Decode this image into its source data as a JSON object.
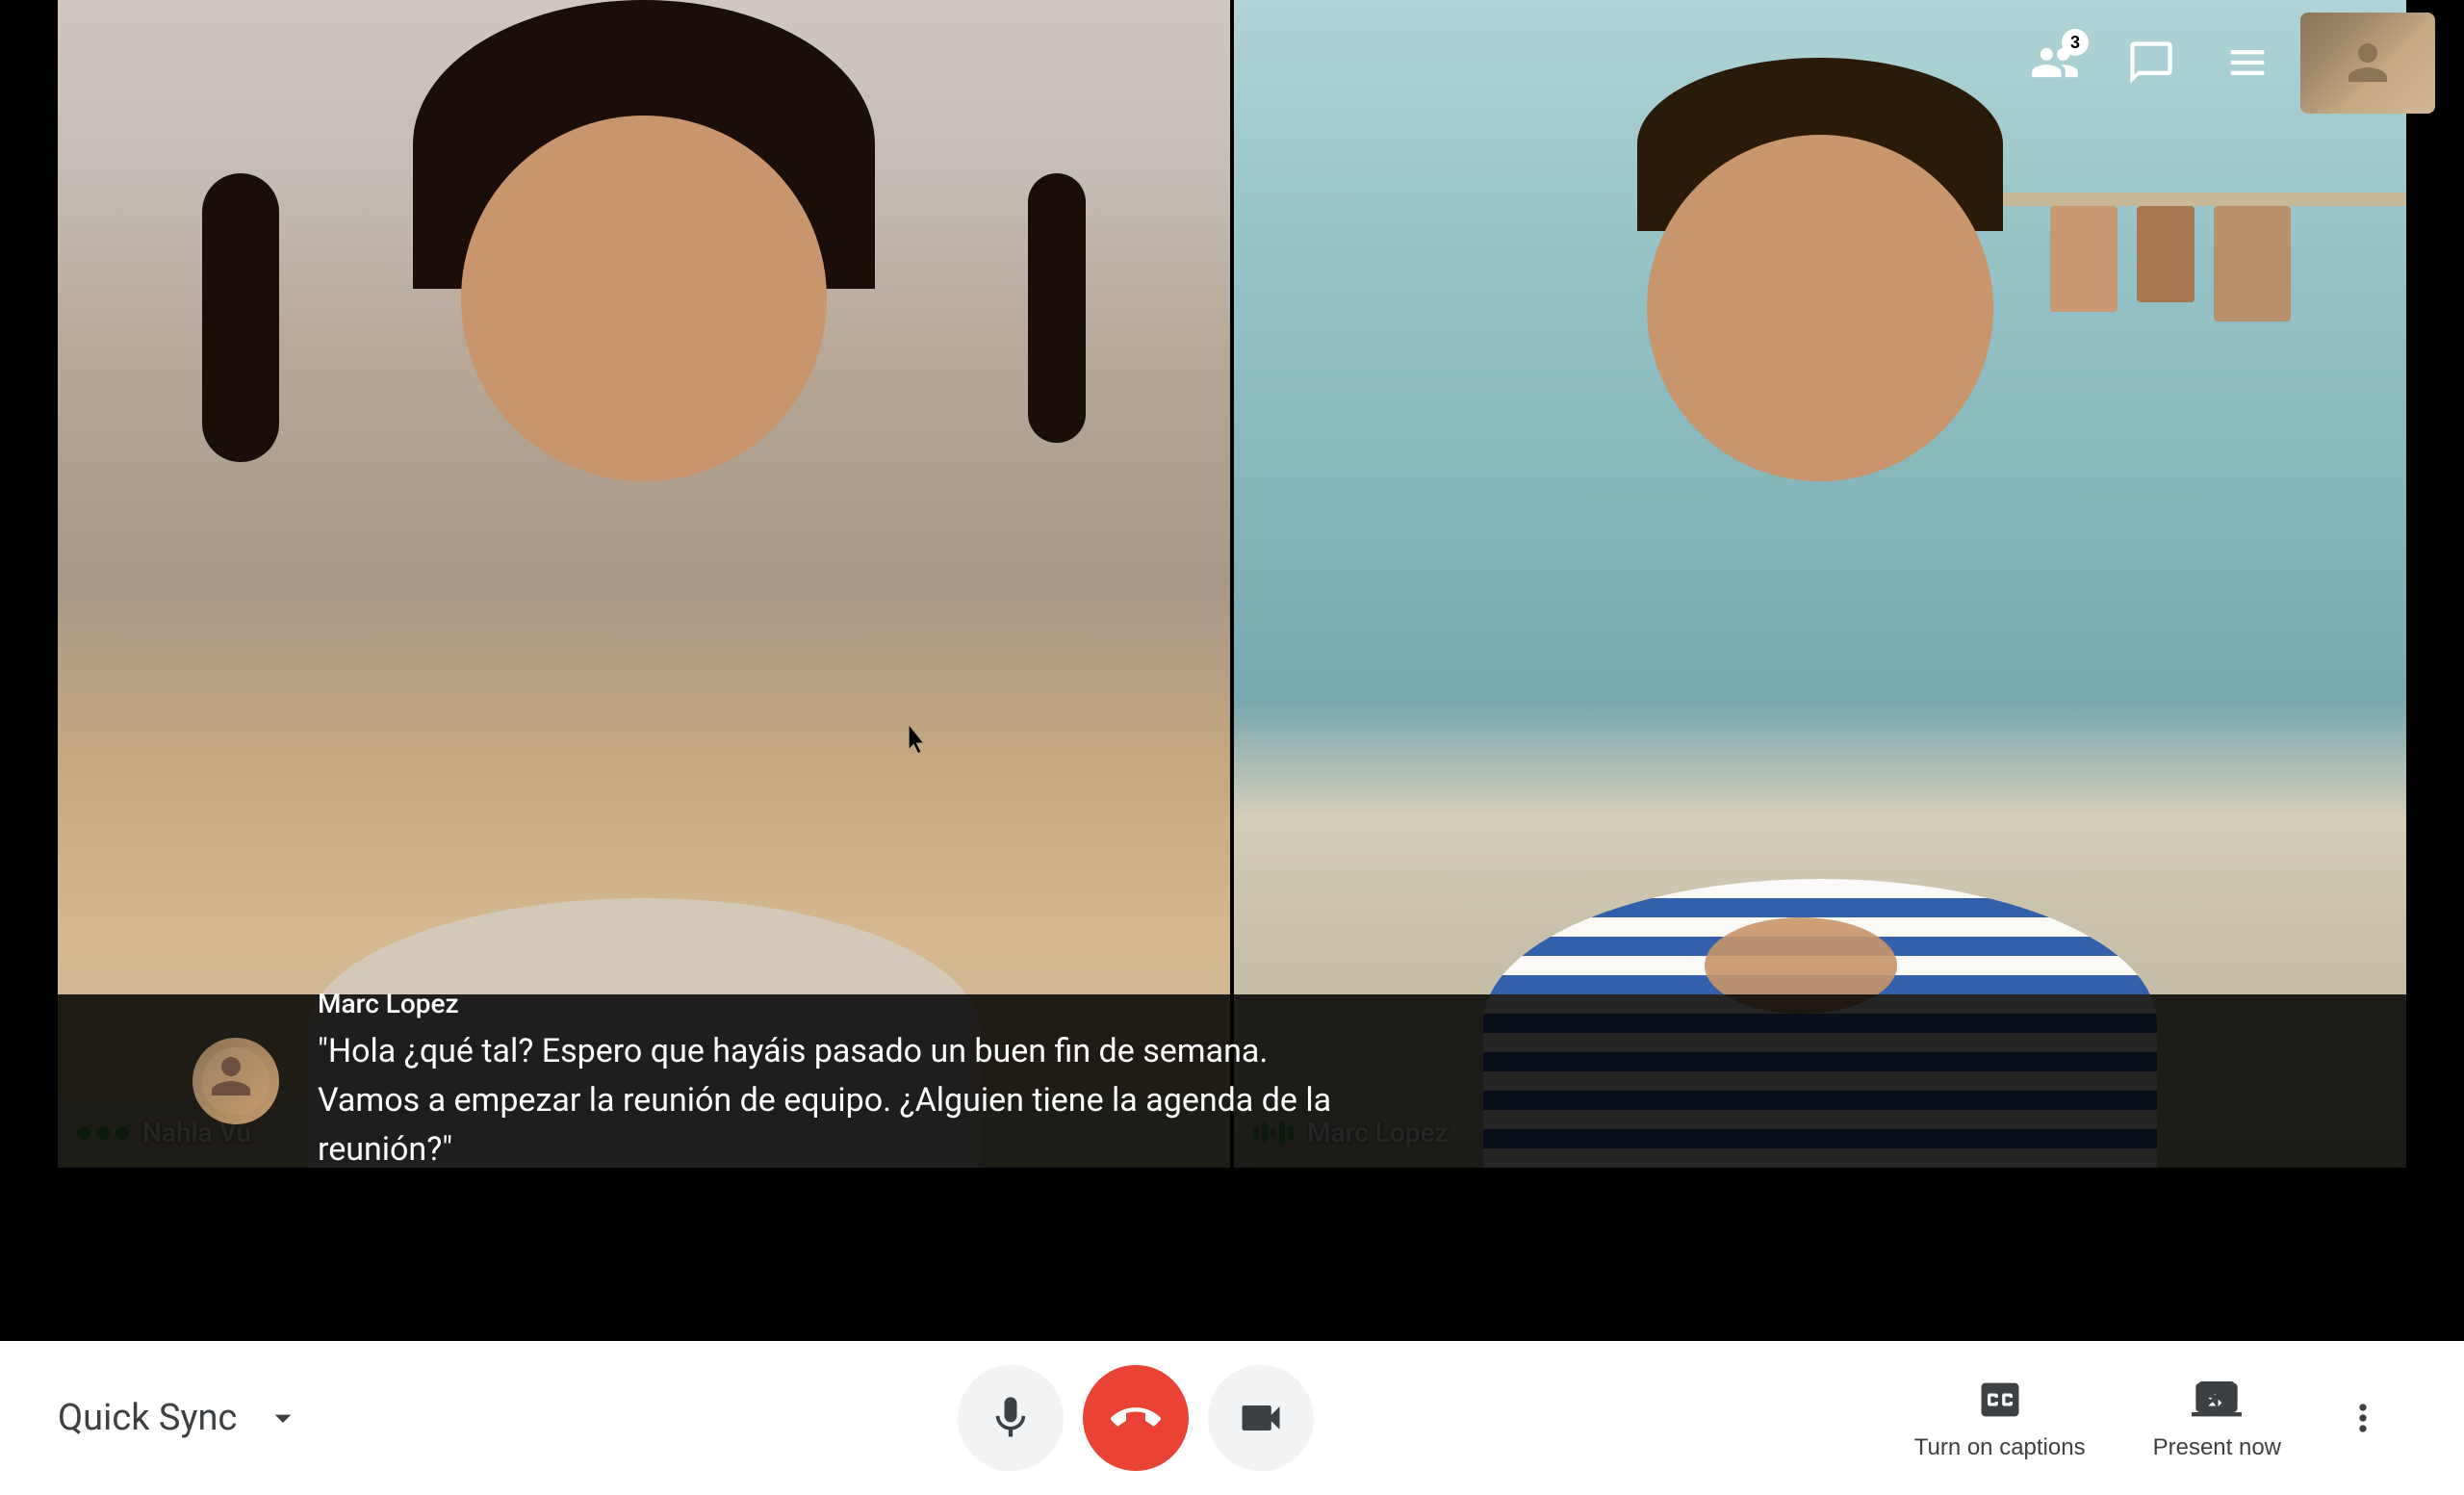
{
  "meeting": {
    "title": "Quick Sync",
    "participant_count": "3"
  },
  "participants": [
    {
      "name": "Nahla Vu",
      "indicator": "dots",
      "position": "left"
    },
    {
      "name": "Marc Lopez",
      "indicator": "audio",
      "position": "right"
    }
  ],
  "caption": {
    "speaker": "Marc Lopez",
    "text": "\"Hola ¿qué tal? Espero que hayáis pasado un buen fin de semana.\nVamos a empezar la reunión de equipo. ¿Alguien tiene la agenda de la\nreunión?\""
  },
  "controls": {
    "mic_label": "Microphone",
    "end_call_label": "End call",
    "camera_label": "Camera",
    "captions_label": "Turn on captions",
    "present_label": "Present now",
    "more_label": "More options"
  },
  "icons": {
    "people": "people-icon",
    "chat": "chat-icon",
    "activities": "activities-icon",
    "mic": "mic-icon",
    "end_call": "end-call-icon",
    "camera": "camera-icon",
    "captions": "captions-icon",
    "present": "present-icon",
    "expand": "expand-icon",
    "more": "more-options-icon"
  }
}
